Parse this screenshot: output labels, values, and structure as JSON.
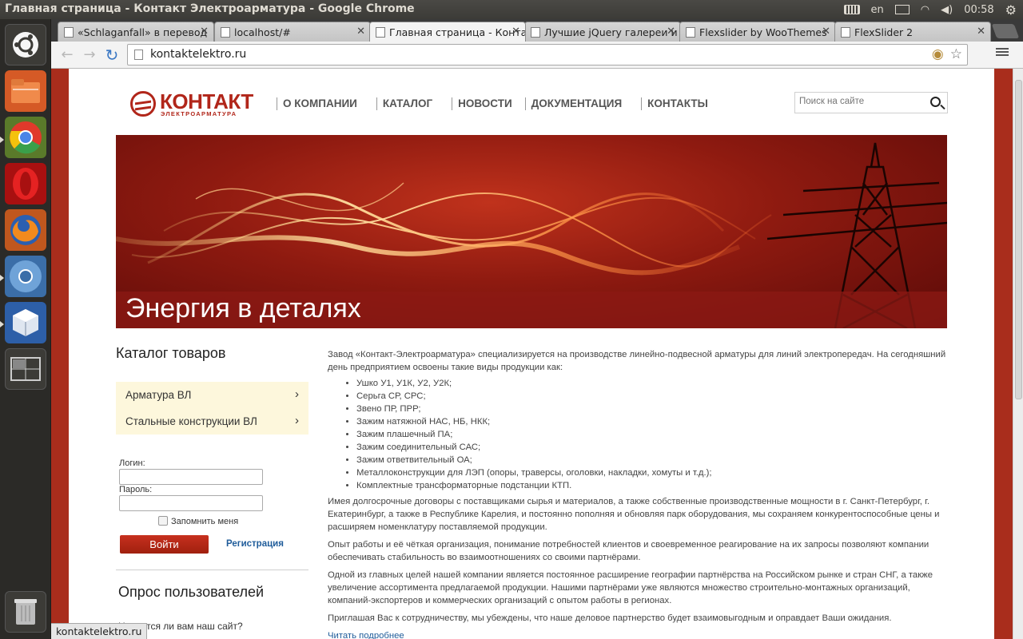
{
  "window": {
    "title": "Главная страница - Контакт Электроарматура - Google Chrome"
  },
  "tray": {
    "lang": "en",
    "clock": "00:58"
  },
  "launcher": {
    "items": [
      "files-icon",
      "chrome-icon",
      "opera-icon",
      "firefox-icon",
      "chromium-icon",
      "virtualbox-icon",
      "workspace-switcher-icon",
      "trash-icon"
    ]
  },
  "tabs": [
    {
      "label": "«Schlaganfall» в перевод",
      "active": false
    },
    {
      "label": "localhost/#",
      "active": false
    },
    {
      "label": "Главная страница - Конта",
      "active": true
    },
    {
      "label": "Лучшие jQuery галереи и",
      "active": false
    },
    {
      "label": "Flexslider by WooThemes",
      "active": false
    },
    {
      "label": "FlexSlider 2",
      "active": false
    }
  ],
  "toolbar": {
    "url": "kontaktelektro.ru"
  },
  "site": {
    "logo_name": "КОНТАКТ",
    "logo_sub": "ЭЛЕКТРОАРМАТУРА",
    "nav": [
      "О КОМПАНИИ",
      "КАТАЛОГ",
      "НОВОСТИ",
      "ДОКУМЕНТАЦИЯ",
      "КОНТАКТЫ"
    ],
    "search_placeholder": "Поиск на сайте",
    "banner_caption": "Энергия в деталях"
  },
  "sidebar": {
    "catalog_title": "Каталог товаров",
    "catalog_items": [
      "Арматура ВЛ",
      "Стальные конструкции ВЛ"
    ],
    "login_label": "Логин:",
    "password_label": "Пароль:",
    "remember_label": "Запомнить меня",
    "login_button": "Войти",
    "register_link": "Регистрация",
    "poll_title": "Опрос пользователей",
    "poll_question": "Нравится ли вам наш сайт?"
  },
  "content": {
    "intro": "Завод «Контакт-Электроарматура» специализируется на производстве линейно-подвесной арматуры для линий электропередач. На сегодняшний день предприятием освоены такие виды продукции как:",
    "products": [
      "Ушко У1, У1К, У2, У2К;",
      "Серьга СР, СРС;",
      "Звено ПР, ПРР;",
      "Зажим натяжной НАС, НБ, НКК;",
      "Зажим плашечный ПА;",
      "Зажим соединительный САС;",
      "Зажим ответвительный ОА;",
      "Металлоконструкции для ЛЭП (опоры, траверсы, оголовки, накладки, хомуты и т.д.);",
      "Комплектные трансформаторные подстанции КТП."
    ],
    "p2": "Имея долгосрочные договоры с поставщиками сырья и материалов, а также собственные производственные мощности в г. Санкт-Петербург, г. Екатеринбург, а также в Республике Карелия, и постоянно пополняя и обновляя парк оборудования, мы сохраняем конкурентоспособные цены и расширяем номенклатуру поставляемой продукции.",
    "p3": "Опыт работы и её чёткая организация, понимание потребностей клиентов и своевременное реагирование на их запросы позволяют компании обеспечивать стабильность во взаимоотношениях со своими партнёрами.",
    "p4": "Одной из главных целей нашей компании является постоянное расширение географии партнёрства на Российском рынке и стран СНГ, а также увеличение ассортимента предлагаемой продукции. Нашими партнёрами уже являются множество строительно-монтажных организаций, компаний-экспортеров и коммерческих организаций с опытом работы в регионах.",
    "p5": "Приглашая Вас к сотрудничеству, мы убеждены, что наше деловое партнерство будет взаимовыгодным и оправдает Ваши ожидания.",
    "read_more": "Читать подробнее"
  },
  "status_bubble": "kontaktelektro.ru"
}
